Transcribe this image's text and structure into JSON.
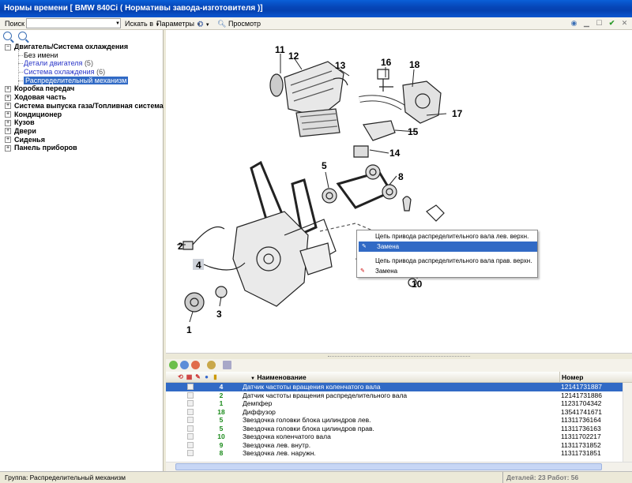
{
  "window": {
    "title": "Нормы времени [ BMW 840Ci ( Нормативы завода-изготовителя )]"
  },
  "toolbar": {
    "search_label": "Поиск",
    "search_value": "",
    "search_in_label": "Искать в",
    "params_label": "Параметры",
    "preview_label": "Просмотр"
  },
  "tree": {
    "sections": [
      {
        "label": "Двигатель/Система охлаждения",
        "expanded": true
      },
      {
        "label": "Коробка передач"
      },
      {
        "label": "Ходовая часть"
      },
      {
        "label": "Система выпуска газа/Топливная система"
      },
      {
        "label": "Кондиционер"
      },
      {
        "label": "Кузов"
      },
      {
        "label": "Двери"
      },
      {
        "label": "Сиденья"
      },
      {
        "label": "Панель приборов"
      }
    ],
    "children": [
      {
        "label": "Без имени",
        "count": ""
      },
      {
        "label": "Детали двигателя",
        "count": "(5)"
      },
      {
        "label": "Система охлаждения",
        "count": "(6)"
      },
      {
        "label": "Распределительный механизм",
        "count": "",
        "selected": true
      }
    ]
  },
  "diagram": {
    "callouts": [
      "1",
      "2",
      "3",
      "4",
      "5",
      "8",
      "10",
      "11",
      "12",
      "13",
      "14",
      "15",
      "16",
      "17",
      "18"
    ]
  },
  "context_menu": {
    "items": [
      {
        "label": "Цепь привода распределительного вала лев. верхн.",
        "kind": "header"
      },
      {
        "label": "Замена",
        "kind": "action",
        "highlighted": true
      },
      {
        "label": "Цепь привода распределительного вала прав. верхн.",
        "kind": "header"
      },
      {
        "label": "Замена",
        "kind": "action"
      }
    ]
  },
  "grid": {
    "columns": {
      "name": "Наименование",
      "number": "Номер"
    },
    "rows": [
      {
        "qty": "4",
        "name": "Датчик частоты вращения коленчатого вала",
        "number": "12141731887",
        "selected": true
      },
      {
        "qty": "2",
        "name": "Датчик частоты вращения распределительного вала",
        "number": "12141731886"
      },
      {
        "qty": "1",
        "name": "Демпфер",
        "number": "11231704342"
      },
      {
        "qty": "18",
        "name": "Диффузор",
        "number": "13541741671"
      },
      {
        "qty": "5",
        "name": "Звездочка головки блока цилиндров лев.",
        "number": "11311736164"
      },
      {
        "qty": "5",
        "name": "Звездочка головки блока цилиндров прав.",
        "number": "11311736163"
      },
      {
        "qty": "10",
        "name": "Звездочка коленчатого вала",
        "number": "11311702217"
      },
      {
        "qty": "9",
        "name": "Звездочка лев. внутр.",
        "number": "11311731852"
      },
      {
        "qty": "8",
        "name": "Звездочка лев. наружн.",
        "number": "11311731851"
      }
    ]
  },
  "status": {
    "group": "Группа: Распределительный механизм",
    "totals": "Деталей: 23 Работ: 56"
  }
}
